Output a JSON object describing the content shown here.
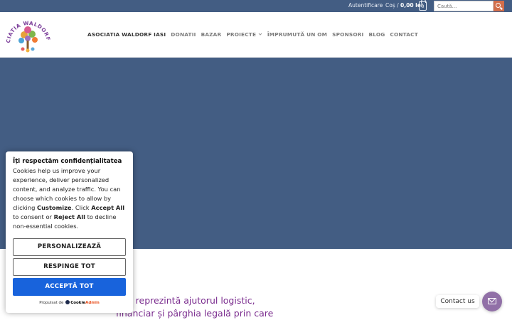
{
  "topbar": {
    "login": "Autentificare",
    "cart_label": "Coș /",
    "cart_amount": "0,00 lei",
    "cart_count": "0",
    "search_placeholder": "Caută..."
  },
  "logo": {
    "text": "ASOCIATIA WALDORF IASI"
  },
  "nav": [
    {
      "label": "ASOCIATIA WALDORF IASI"
    },
    {
      "label": "DONATII"
    },
    {
      "label": "BAZAR"
    },
    {
      "label": "PROIECTE"
    },
    {
      "label": "ÎMPRUMUTĂ UN OM"
    },
    {
      "label": "SPONSORI"
    },
    {
      "label": "BLOG"
    },
    {
      "label": "CONTACT"
    }
  ],
  "body": {
    "line1": "ația reprezintă ajutorul logistic,",
    "line2": "financiar și pârghia legală prin care"
  },
  "cookie": {
    "title": "Îți respectăm confidențialitatea",
    "msg_1": "Cookies help us improve your experience, deliver personalized content, and analyze traffic. You can choose which cookies to allow by clicking ",
    "msg_customize": "Customize",
    "msg_2": ". Click ",
    "msg_accept": "Accept All",
    "msg_3": " to consent or ",
    "msg_reject": "Reject All",
    "msg_4": " to decline non-essential cookies.",
    "btn_customize": "PERSONALIZEAZĂ",
    "btn_reject": "RESPINGE TOT",
    "btn_accept": "ACCEPTĂ TOT",
    "powered_by": "Propulsat de",
    "brand_a": "Cookie",
    "brand_b": "Admin"
  },
  "contact": {
    "label": "Contact us"
  },
  "colors": {
    "topbar": "#435d83",
    "hero": "#435d83",
    "accent": "#d26e4b",
    "primary_button": "#1863dc",
    "body_text": "#7a2c8e",
    "contact_button": "#9170a7"
  }
}
